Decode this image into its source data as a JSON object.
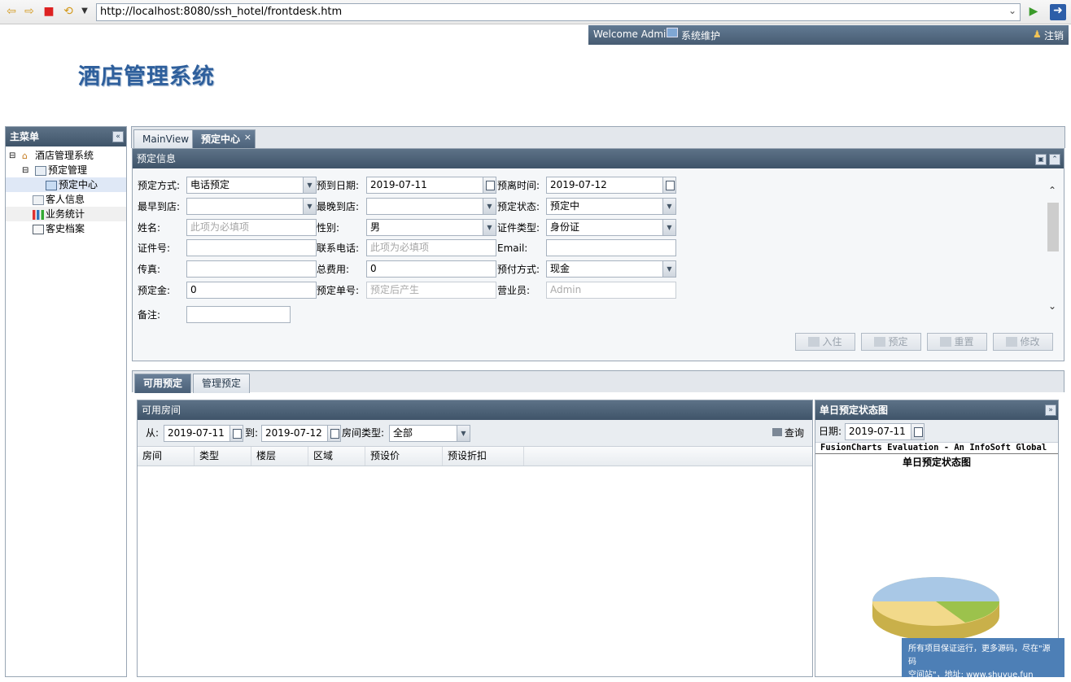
{
  "browser": {
    "url": "http://localhost:8080/ssh_hotel/frontdesk.htm"
  },
  "header": {
    "welcome": "Welcome Admin",
    "maintenance": "系统维护",
    "logout": "注销",
    "app_title": "酒店管理系统"
  },
  "sidebar": {
    "title": "主菜单",
    "items": [
      {
        "label": "酒店管理系统"
      },
      {
        "label": "预定管理"
      },
      {
        "label": "预定中心"
      },
      {
        "label": "客人信息"
      },
      {
        "label": "业务统计"
      },
      {
        "label": "客史档案"
      }
    ]
  },
  "tabs": [
    {
      "label": "MainView"
    },
    {
      "label": "预定中心"
    }
  ],
  "booking": {
    "title": "预定信息",
    "fields": {
      "method_label": "预定方式:",
      "method_value": "电话预定",
      "arrival_label": "预到日期:",
      "arrival_value": "2019-07-11",
      "depart_label": "预离时间:",
      "depart_value": "2019-07-12",
      "earliest_label": "最早到店:",
      "earliest_value": "",
      "latest_label": "最晚到店:",
      "latest_value": "",
      "status_label": "预定状态:",
      "status_value": "预定中",
      "name_label": "姓名:",
      "name_placeholder": "此项为必填项",
      "gender_label": "性别:",
      "gender_value": "男",
      "idtype_label": "证件类型:",
      "idtype_value": "身份证",
      "idno_label": "证件号:",
      "idno_value": "",
      "phone_label": "联系电话:",
      "phone_placeholder": "此项为必填项",
      "email_label": "Email:",
      "email_value": "",
      "fax_label": "传真:",
      "fax_value": "",
      "total_label": "总费用:",
      "total_value": "0",
      "paymethod_label": "预付方式:",
      "paymethod_value": "现金",
      "deposit_label": "预定金:",
      "deposit_value": "0",
      "orderno_label": "预定单号:",
      "orderno_placeholder": "预定后产生",
      "clerk_label": "营业员:",
      "clerk_value": "Admin",
      "remark_label": "备注:",
      "remark_value": ""
    },
    "buttons": {
      "checkin": "入住",
      "reserve": "预定",
      "reset": "重置",
      "modify": "修改"
    }
  },
  "lower_tabs": [
    {
      "label": "可用预定"
    },
    {
      "label": "管理预定"
    }
  ],
  "rooms": {
    "title": "可用房间",
    "from_label": "从:",
    "from_value": "2019-07-11",
    "to_label": "到:",
    "to_value": "2019-07-12",
    "type_label": "房间类型:",
    "type_value": "全部",
    "query_label": "查询",
    "columns": [
      "房间",
      "类型",
      "楼层",
      "区域",
      "预设价",
      "预设折扣"
    ]
  },
  "day_status": {
    "title": "单日预定状态图",
    "date_label": "日期:",
    "date_value": "2019-07-11",
    "chart_banner": "FusionCharts Evaluation - An InfoSoft Global",
    "chart_title": "单日预定状态图"
  },
  "notice": {
    "line1": "所有项目保证运行，更多源码，尽在\"源码",
    "line2": "空间站\"，地址: www.shuyue.fun"
  }
}
